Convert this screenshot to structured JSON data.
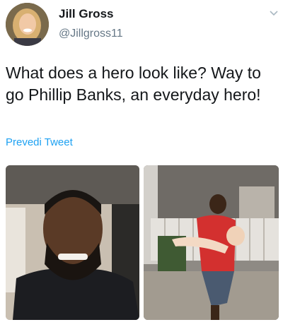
{
  "author": {
    "display_name": "Jill Gross",
    "handle": "@Jillgross11",
    "avatar_icon": "profile-photo",
    "menu_icon": "chevron-down-icon"
  },
  "tweet": {
    "text": "What does a hero look like?  Way to go Phillip Banks, an everyday hero!",
    "translate_label": "Prevedi Tweet"
  },
  "media": [
    {
      "icon": "selfie-photo"
    },
    {
      "icon": "rescue-photo"
    }
  ],
  "colors": {
    "text": "#14171a",
    "secondary": "#657786",
    "link": "#1da1f2"
  }
}
